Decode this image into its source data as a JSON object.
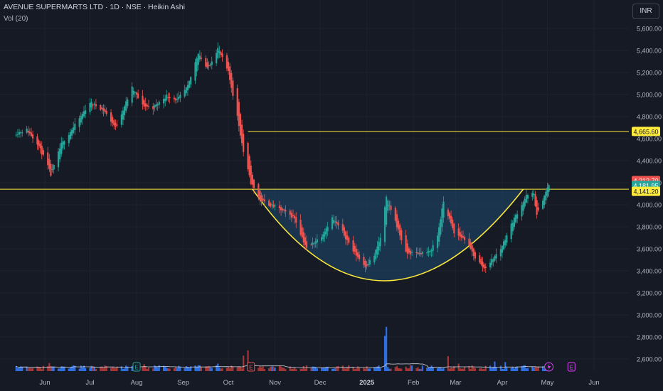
{
  "header": {
    "symbol": "AVENUE SUPERMARTS LTD",
    "interval": "1D",
    "exchange": "NSE",
    "chart_style": "Heikin Ashi",
    "title_line": "AVENUE SUPERMARTS LTD · 1D · NSE · Heikin Ashi",
    "indicator": "Vol (20)"
  },
  "currency_button": "INR",
  "colors": {
    "background": "#161a25",
    "bullish": "#26a69a",
    "bearish": "#ef5350",
    "volume_up": "#3179f5",
    "volume_down": "#b23a37",
    "pattern_line": "#ffeb3b",
    "pattern_fill": "#1e4a6e",
    "axis_text": "#b2b5be",
    "grid": "#1e222d"
  },
  "chart_data": {
    "type": "candlestick",
    "price_axis": {
      "ticks": [
        "5,600.00",
        "5,400.00",
        "5,200.00",
        "5,000.00",
        "4,800.00",
        "4,600.00",
        "4,400.00",
        "4,200.00",
        "4,000.00",
        "3,800.00",
        "3,600.00",
        "3,400.00",
        "3,200.00",
        "3,000.00",
        "2,800.00",
        "2,600.00"
      ],
      "range": [
        2500,
        5700
      ]
    },
    "time_axis": {
      "labels": [
        "Jun",
        "Jul",
        "Aug",
        "Sep",
        "Oct",
        "Nov",
        "Dec",
        "2025",
        "Feb",
        "Mar",
        "Apr",
        "May",
        "Jun"
      ]
    },
    "price_labels": [
      {
        "value": 4665.6,
        "text": "4,665.60",
        "kind": "line"
      },
      {
        "value": 4212.7,
        "text": "4,212.70",
        "kind": "high"
      },
      {
        "value": 4181.95,
        "text": "4,181.95",
        "kind": "last"
      },
      {
        "value": 4141.2,
        "text": "4,141.20",
        "kind": "line"
      }
    ],
    "horizontal_lines": [
      {
        "value": 4665.6,
        "color": "#ffeb3b"
      },
      {
        "value": 4141.2,
        "color": "#ffeb3b"
      }
    ],
    "cup_pattern": {
      "rim_value": 4141.2,
      "bottom_value": 3310,
      "start_date": "2024-10-17",
      "bottom_date": "2025-01-10",
      "end_date": "2025-04-15"
    },
    "keypoints": [
      [
        "2024-05-13",
        4650
      ],
      [
        "2024-05-20",
        4680
      ],
      [
        "2024-05-27",
        4560
      ],
      [
        "2024-06-03",
        4350
      ],
      [
        "2024-06-05",
        4270
      ],
      [
        "2024-06-12",
        4550
      ],
      [
        "2024-06-21",
        4720
      ],
      [
        "2024-07-01",
        4930
      ],
      [
        "2024-07-10",
        4860
      ],
      [
        "2024-07-18",
        4700
      ],
      [
        "2024-07-29",
        5060
      ],
      [
        "2024-08-05",
        4900
      ],
      [
        "2024-08-12",
        4880
      ],
      [
        "2024-08-21",
        4990
      ],
      [
        "2024-08-28",
        4950
      ],
      [
        "2024-09-04",
        5070
      ],
      [
        "2024-09-11",
        5380
      ],
      [
        "2024-09-17",
        5230
      ],
      [
        "2024-09-24",
        5420
      ],
      [
        "2024-10-01",
        5200
      ],
      [
        "2024-10-07",
        4800
      ],
      [
        "2024-10-11",
        4480
      ],
      [
        "2024-10-16",
        4200
      ],
      [
        "2024-10-22",
        4040
      ],
      [
        "2024-11-04",
        3960
      ],
      [
        "2024-11-14",
        3880
      ],
      [
        "2024-11-22",
        3600
      ],
      [
        "2024-12-02",
        3720
      ],
      [
        "2024-12-09",
        3880
      ],
      [
        "2024-12-16",
        3750
      ],
      [
        "2024-12-23",
        3580
      ],
      [
        "2024-12-31",
        3440
      ],
      [
        "2025-01-06",
        3540
      ],
      [
        "2025-01-10",
        3700
      ],
      [
        "2025-01-14",
        4060
      ],
      [
        "2025-01-20",
        3850
      ],
      [
        "2025-01-27",
        3560
      ],
      [
        "2025-02-03",
        3560
      ],
      [
        "2025-02-12",
        3570
      ],
      [
        "2025-02-17",
        3720
      ],
      [
        "2025-02-21",
        4030
      ],
      [
        "2025-02-28",
        3740
      ],
      [
        "2025-03-07",
        3690
      ],
      [
        "2025-03-14",
        3520
      ],
      [
        "2025-03-20",
        3420
      ],
      [
        "2025-03-24",
        3480
      ],
      [
        "2025-03-31",
        3600
      ],
      [
        "2025-04-08",
        3850
      ],
      [
        "2025-04-17",
        4080
      ],
      [
        "2025-04-22",
        4100
      ],
      [
        "2025-04-24",
        3900
      ],
      [
        "2025-04-28",
        4050
      ],
      [
        "2025-05-02",
        4181.95
      ]
    ],
    "volume_spikes": [
      [
        "2024-10-11",
        2.9
      ],
      [
        "2024-10-14",
        3.9
      ],
      [
        "2025-01-13",
        6.6
      ],
      [
        "2025-01-14",
        8.3
      ],
      [
        "2025-02-24",
        2.8
      ],
      [
        "2025-03-27",
        1.8
      ],
      [
        "2025-04-03",
        1.7
      ],
      [
        "2024-06-04",
        1.5
      ],
      [
        "2024-09-24",
        1.4
      ],
      [
        "2024-08-06",
        1.3
      ],
      [
        "2025-03-03",
        1.4
      ]
    ],
    "volume_average_label": "Vol (20)",
    "event_markers": [
      {
        "date": "2024-08-01",
        "text": "E",
        "color": "#26a69a"
      },
      {
        "date": "2024-10-16",
        "text": "E",
        "color": "#ef5350"
      },
      {
        "date": "2025-05-17",
        "text": "E",
        "color": "#e040fb"
      }
    ],
    "dividend_marker": {
      "date": "2025-05-02",
      "color": "#e040fb"
    }
  }
}
